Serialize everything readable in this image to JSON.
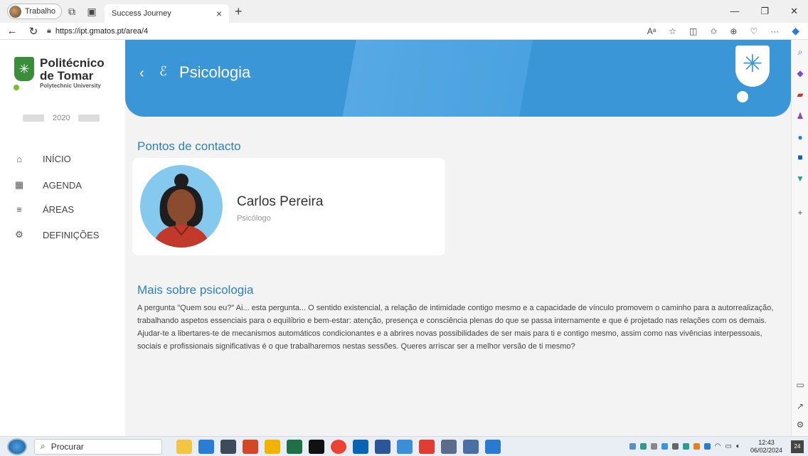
{
  "browser": {
    "profile": "Trabalho",
    "tab_title": "Success Journey",
    "url": "https://ipt.gmatos.pt/area/4"
  },
  "brand": {
    "name_line1": "Politécnico",
    "name_line2": "de Tomar",
    "subtitle": "Polytechnic University",
    "partner_logo": "2020",
    "accent": "#3b96d8",
    "green": "#3a8d3a"
  },
  "sidebar": {
    "items": [
      {
        "label": "INÍCIO",
        "icon": "home-icon"
      },
      {
        "label": "AGENDA",
        "icon": "calendar-icon"
      },
      {
        "label": "ÁREAS",
        "icon": "menu-icon"
      },
      {
        "label": "DEFINIÇÕES",
        "icon": "settings-icon"
      }
    ]
  },
  "header": {
    "title": "Psicologia"
  },
  "contacts": {
    "heading": "Pontos de contacto",
    "name": "Carlos Pereira",
    "role": "Psicólogo"
  },
  "about": {
    "heading": "Mais sobre psicologia",
    "text": "A pergunta \"Quem sou eu?\" Ai... esta pergunta... O sentido existencial, a relação de intimidade contigo mesmo e a capacidade de vínculo promovem o caminho para a autorrealização, trabalhando aspetos essenciais para o equilíbrio e bem-estar: atenção, presença e consciência plenas do que se passa internamente e que é projetado nas relações com os demais. Ajudar-te a libertares-te de mecanismos automáticos condicionantes e a abrires novas possibilidades de ser mais para ti e contigo mesmo, assim como nas vivências interpessoais, sociais e profissionais significativas é o que trabalharemos nestas sessões. Queres arriscar ser a melhor versão de ti mesmo?"
  },
  "taskbar": {
    "search": "Procurar",
    "time": "12:43",
    "date": "06/02/2024",
    "notifications": "24"
  }
}
